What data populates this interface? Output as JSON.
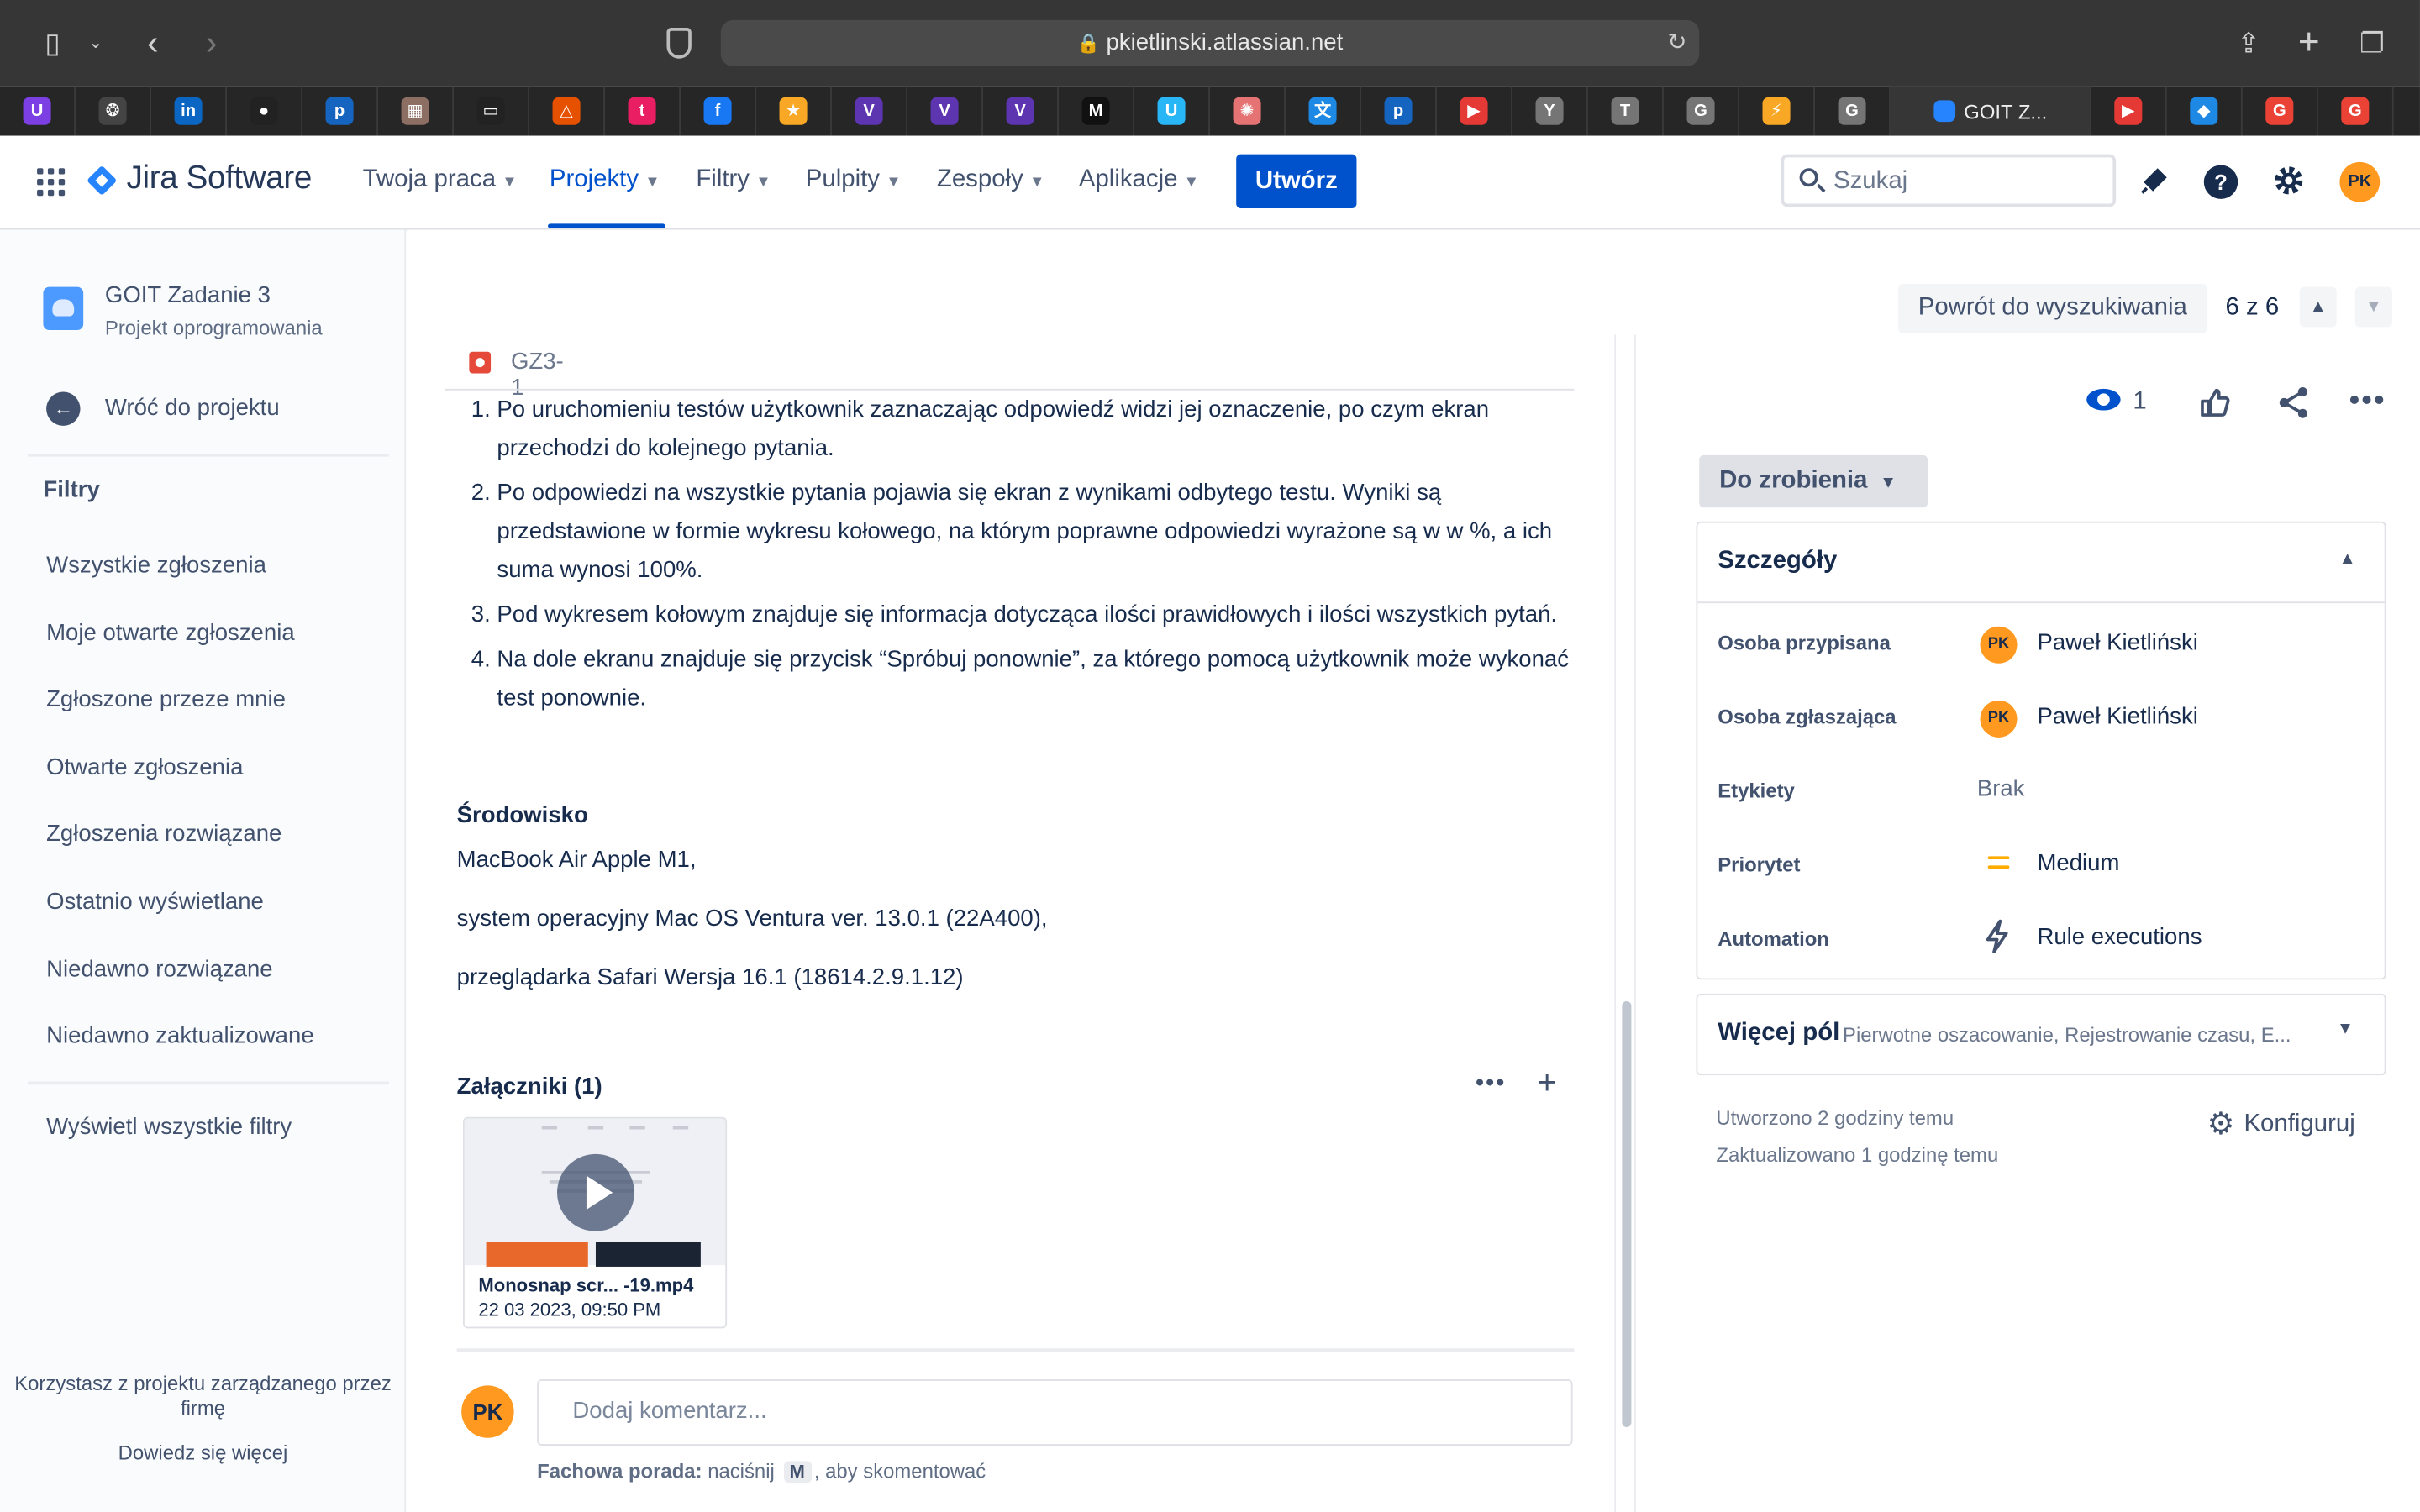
{
  "browser": {
    "url": "pkietlinski.atlassian.net",
    "active_tab_label": "GOIT Z...",
    "bookmarks": [
      {
        "icon": "u-icon",
        "glyph": "U",
        "color": "#7b3fe4"
      },
      {
        "icon": "brain-icon",
        "glyph": "❂",
        "color": "#444"
      },
      {
        "icon": "linkedin-icon",
        "glyph": "in",
        "color": "#0a66c2"
      },
      {
        "icon": "github-icon",
        "glyph": "●",
        "color": "#222"
      },
      {
        "icon": "p-icon",
        "glyph": "p",
        "color": "#1565c0"
      },
      {
        "icon": "photo-icon",
        "glyph": "▦",
        "color": "#8d6e63"
      },
      {
        "icon": "reader-icon",
        "glyph": "▭",
        "color": "#222"
      },
      {
        "icon": "triangle-icon",
        "glyph": "△",
        "color": "#e65100"
      },
      {
        "icon": "t-icon",
        "glyph": "t",
        "color": "#e91e63"
      },
      {
        "icon": "facebook-icon",
        "glyph": "f",
        "color": "#1877f2"
      },
      {
        "icon": "star-icon",
        "glyph": "★",
        "color": "#f9a825"
      },
      {
        "icon": "v-icon",
        "glyph": "V",
        "color": "#5e35b1"
      },
      {
        "icon": "v-icon",
        "glyph": "V",
        "color": "#5e35b1"
      },
      {
        "icon": "v-icon",
        "glyph": "V",
        "color": "#5e35b1"
      },
      {
        "icon": "m-icon",
        "glyph": "M",
        "color": "#111"
      },
      {
        "icon": "u-circle-icon",
        "glyph": "U",
        "color": "#29b6f6"
      },
      {
        "icon": "openai-icon",
        "glyph": "✺",
        "color": "#e57373"
      },
      {
        "icon": "translate-icon",
        "glyph": "文",
        "color": "#1e88e5"
      },
      {
        "icon": "p-icon",
        "glyph": "p",
        "color": "#1565c0"
      },
      {
        "icon": "youtube-icon",
        "glyph": "▶",
        "color": "#e53935"
      },
      {
        "icon": "y-icon",
        "glyph": "Y",
        "color": "#757575"
      },
      {
        "icon": "t-gray-icon",
        "glyph": "T",
        "color": "#757575"
      },
      {
        "icon": "g-gray-icon",
        "glyph": "G",
        "color": "#757575"
      },
      {
        "icon": "bolt-icon",
        "glyph": "⚡",
        "color": "#f9a825"
      },
      {
        "icon": "g-gray-icon",
        "glyph": "G",
        "color": "#757575"
      }
    ],
    "bookmarks_after": [
      {
        "icon": "youtube-icon",
        "glyph": "▶",
        "color": "#e53935"
      },
      {
        "icon": "flag-icon",
        "glyph": "◆",
        "color": "#1e88e5"
      },
      {
        "icon": "google-icon",
        "glyph": "G",
        "color": "#ea4335"
      },
      {
        "icon": "google-icon",
        "glyph": "G",
        "color": "#ea4335"
      }
    ]
  },
  "nav": {
    "product": "Jira Software",
    "items": [
      "Twoja praca",
      "Projekty",
      "Filtry",
      "Pulpity",
      "Zespoły",
      "Aplikacje"
    ],
    "create": "Utwórz",
    "search_placeholder": "Szukaj",
    "user_initials": "PK"
  },
  "sidebar": {
    "project_name": "GOIT Zadanie 3",
    "project_type": "Projekt oprogramowania",
    "back": "Wróć do projektu",
    "filters_heading": "Filtry",
    "filters": [
      "Wszystkie zgłoszenia",
      "Moje otwarte zgłoszenia",
      "Zgłoszone przeze mnie",
      "Otwarte zgłoszenia",
      "Zgłoszenia rozwiązane",
      "Ostatnio wyświetlane",
      "Niedawno rozwiązane",
      "Niedawno zaktualizowane"
    ],
    "all_filters": "Wyświetl wszystkie filtry",
    "footer": "Korzystasz z projektu zarządzanego przez firmę",
    "footer_link": "Dowiedz się więcej"
  },
  "issue": {
    "back_to_search": "Powrót do wyszukiwania",
    "pager": "6 z 6",
    "key": "GZ3-1",
    "steps": [
      "Po uruchomieniu testów użytkownik zaznaczając odpowiedź widzi jej oznaczenie, po czym ekran przechodzi do kolejnego pytania.",
      "Po odpowiedzi na wszystkie pytania pojawia się ekran z wynikami odbytego testu. Wyniki są przedstawione w formie wykresu kołowego, na którym poprawne odpowiedzi wyrażone są w w %, a ich suma wynosi 100%.",
      "Pod wykresem kołowym znajduje się informacja dotycząca ilości prawidłowych i ilości wszystkich pytań.",
      "Na dole ekranu znajduje się przycisk “Spróbuj  ponownie”, za którego pomocą użytkownik może wykonać test ponownie."
    ],
    "env_heading": "Środowisko",
    "env_lines": [
      "MacBook Air Apple M1,",
      "system operacyjny Mac OS Ventura ver. 13.0.1 (22A400),",
      "przeglądarka Safari Wersja 16.1 (18614.2.9.1.12)"
    ],
    "attachments_heading": "Załączniki (1)",
    "attachment": {
      "name": "Monosnap scr...  -19.mp4",
      "date": "22 03 2023, 09:50 PM"
    },
    "comment_initials": "PK",
    "comment_placeholder": "Dodaj komentarz...",
    "tip_bold": "Fachowa porada:",
    "tip_pre": " naciśnij ",
    "tip_key": "M",
    "tip_post": ", aby skomentować"
  },
  "panel": {
    "watchers": "1",
    "status": "Do zrobienia",
    "details_title": "Szczegóły",
    "fields": [
      {
        "label": "Osoba przypisana",
        "value": "Paweł Kietliński",
        "initials": "PK"
      },
      {
        "label": "Osoba zgłaszająca",
        "value": "Paweł Kietliński",
        "initials": "PK"
      },
      {
        "label": "Etykiety",
        "value": "Brak"
      },
      {
        "label": "Priorytet",
        "value": "Medium"
      },
      {
        "label": "Automation",
        "value": "Rule executions"
      }
    ],
    "more_title": "Więcej pól",
    "more_sub": "Pierwotne oszacowanie, Rejestrowanie czasu, E...",
    "created": "Utworzono 2 godziny temu",
    "updated": "Zaktualizowano 1 godzinę temu",
    "configure": "Konfiguruj"
  },
  "colors": {
    "brand": "#0052cc",
    "avatar": "#ff991f",
    "bug": "#e5493a",
    "priority_medium": "#ffab00"
  }
}
